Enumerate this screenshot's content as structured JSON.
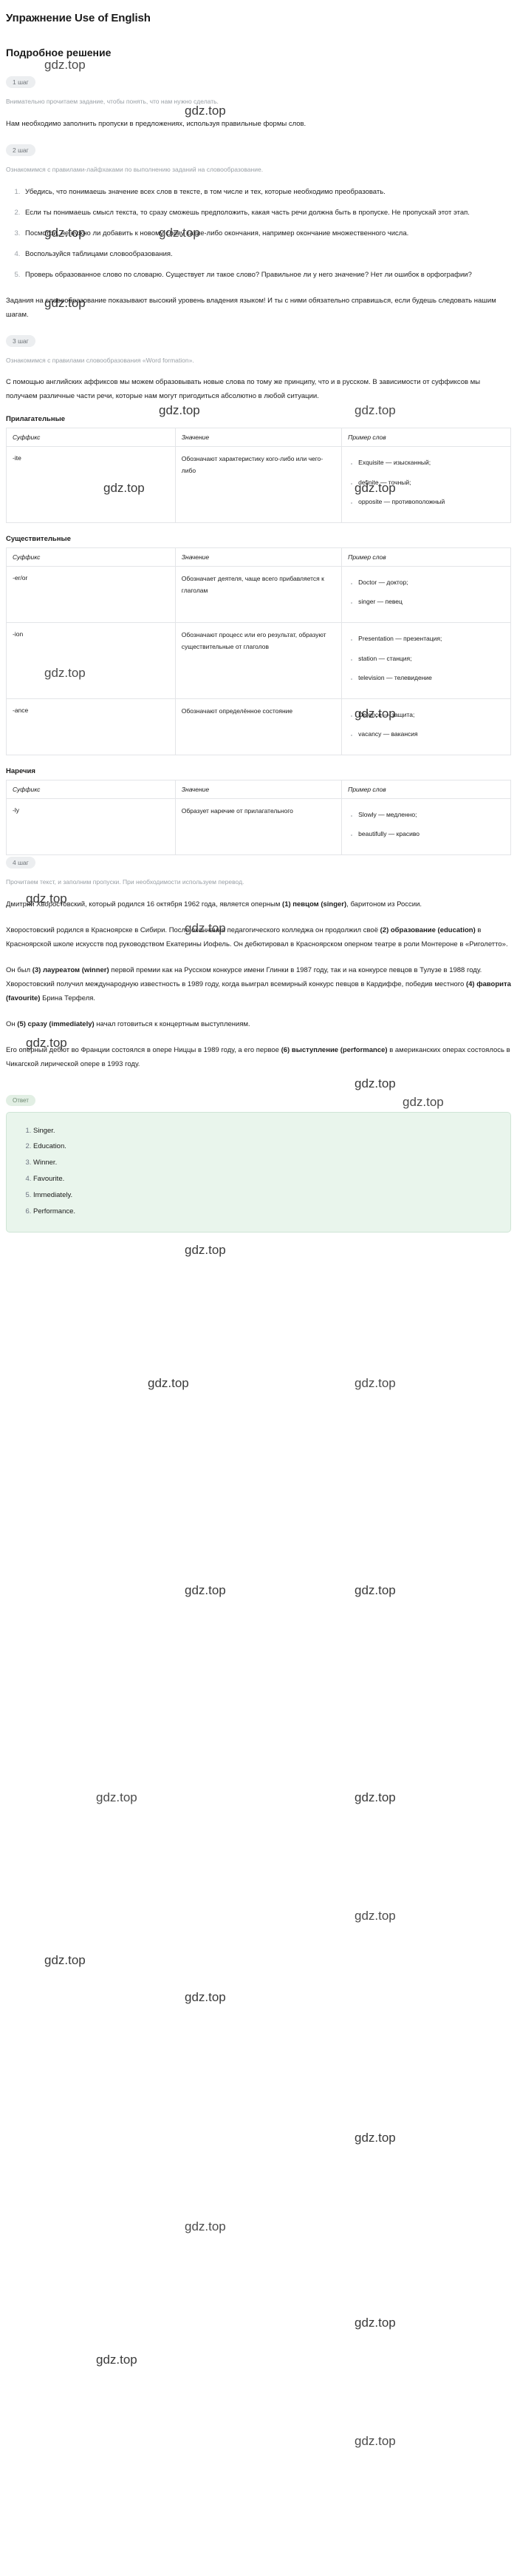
{
  "page": {
    "title": "Упражнение Use of English",
    "subtitle": "Подробное решение",
    "watermark_text": "gdz.top"
  },
  "steps": [
    {
      "badge": "1 шаг",
      "note": "Внимательно прочитаем задание, чтобы понять, что нам нужно сделать.",
      "body": "Нам необходимо заполнить пропуски в предложениях, используя правильные формы слов."
    },
    {
      "badge": "2 шаг",
      "note": "Ознакомимся с правилами-лайфхаками по выполнению заданий на словообразование.",
      "tips": [
        "Убедись, что понимаешь значение всех слов в тексте, в том числе и тех, которые необходимо преобразовать.",
        "Если ты понимаешь смысл текста, то сразу сможешь предположить, какая часть речи должна быть в пропуске. Не пропускай этот этап.",
        "Посмотри, не нужно ли добавить к новому слову какие-либо окончания, например окончание множественного числа.",
        "Воспользуйся таблицами словообразования.",
        "Проверь образованное слово по словарю. Существует ли такое слово? Правильное ли у него значение? Нет ли ошибок в орфографии?"
      ],
      "closing": "Задания на словообразование показывают высокий уровень владения языком! И ты с ними обязательно справишься, если будешь следовать нашим шагам."
    },
    {
      "badge": "3 шаг",
      "note": "Ознакомимся с правилами словообразования «Word formation».",
      "body": "С помощью английских аффиксов мы можем образовывать новые слова по тому же принципу, что и в русском. В зависимости от суффиксов мы получаем различные части речи, которые нам могут пригодиться абсолютно в любой ситуации."
    },
    {
      "badge": "4 шаг",
      "note": "Прочитаем текст, и заполним пропуски. При необходимости используем перевод."
    }
  ],
  "tables": [
    {
      "title": "Прилагательные",
      "headers": [
        "Суффикс",
        "Значение",
        "Пример слов"
      ],
      "rows": [
        {
          "suffix": "-ite",
          "meaning": "Обозначают характеристику кого-либо или чего-либо",
          "examples": [
            "Exquisite — изысканный;",
            "definite — точный;",
            "opposite — противоположный"
          ]
        }
      ]
    },
    {
      "title": "Существительные",
      "headers": [
        "Суффикс",
        "Значение",
        "Пример слов"
      ],
      "rows": [
        {
          "suffix": "-er/or",
          "meaning": "Обозначает деятеля, чаще всего прибавляется к глаголам",
          "examples": [
            "Doctor — доктор;",
            "singer — певец"
          ]
        },
        {
          "suffix": "-ion",
          "meaning": "Обозначают процесс или его результат, образуют существительные от глаголов",
          "examples": [
            "Presentation — презентация;",
            "station — станция;",
            "television — телевидение"
          ]
        },
        {
          "suffix": "-ance",
          "meaning": "Обозначают определённое состояние",
          "examples": [
            "Defence — защита;",
            "vacancy — вакансия"
          ]
        }
      ]
    },
    {
      "title": "Наречия",
      "headers": [
        "Суффикс",
        "Значение",
        "Пример слов"
      ],
      "rows": [
        {
          "suffix": "-ly",
          "meaning": "Образует наречие от прилагательного",
          "examples": [
            "Slowly — медленно;",
            "beautifully — красиво"
          ]
        }
      ]
    }
  ],
  "passage": [
    {
      "parts": [
        {
          "t": "Дмитрий Хворостовский, который родился 16 октября 1962 года, является оперным ",
          "b": false
        },
        {
          "t": "(1) певцом (singer)",
          "b": true
        },
        {
          "t": ", баритоном из России.",
          "b": false
        }
      ]
    },
    {
      "parts": [
        {
          "t": "Хворостовский родился в Красноярске в Сибири. После окончания педагогического колледжа он продолжил своё ",
          "b": false
        },
        {
          "t": "(2) образование (education)",
          "b": true
        },
        {
          "t": " в Красноярской школе искусств под руководством Екатерины Иофель. Он дебютировал в Красноярском оперном театре в роли Монтероне в «Риголетто».",
          "b": false
        }
      ]
    },
    {
      "parts": [
        {
          "t": "Он был ",
          "b": false
        },
        {
          "t": "(3) лауреатом (winner)",
          "b": true
        },
        {
          "t": " первой премии как на Русском конкурсе имени Глинки в 1987 году, так и на конкурсе певцов в Тулузе в 1988 году. Хворостовский получил международную известность в 1989 году, когда выиграл всемирный конкурс певцов в Кардиффе, победив местного ",
          "b": false
        },
        {
          "t": "(4) фаворита (favourite)",
          "b": true
        },
        {
          "t": " Брина Терфеля.",
          "b": false
        }
      ]
    },
    {
      "parts": [
        {
          "t": "Он ",
          "b": false
        },
        {
          "t": "(5) сразу (immediately)",
          "b": true
        },
        {
          "t": " начал готовиться к концертным выступлениям.",
          "b": false
        }
      ]
    },
    {
      "parts": [
        {
          "t": "Его оперный дебют во Франции состоялся в опере Ниццы в 1989 году, а его первое ",
          "b": false
        },
        {
          "t": "(6) выступление (performance)",
          "b": true
        },
        {
          "t": " в американских операх состоялось в Чикагской лирической опере в 1993 году.",
          "b": false
        }
      ]
    }
  ],
  "answer": {
    "badge": "Ответ",
    "items": [
      "Singer.",
      "Education.",
      "Winner.",
      "Favourite.",
      "Immediately.",
      "Performance."
    ]
  }
}
